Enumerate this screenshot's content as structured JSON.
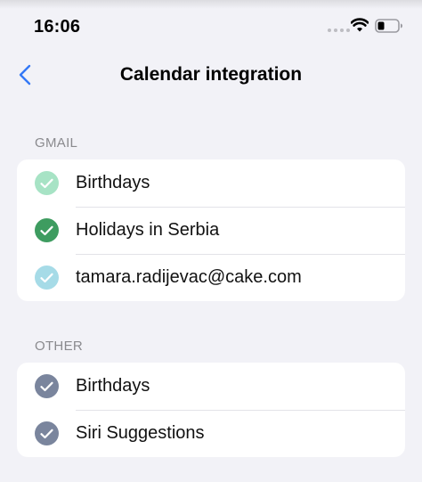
{
  "status_bar": {
    "time": "16:06",
    "icons": [
      "signal-dots-icon",
      "wifi-icon",
      "battery-icon"
    ]
  },
  "nav": {
    "back_icon": "chevron-left-icon",
    "title": "Calendar integration",
    "accent_color": "#3478f6"
  },
  "sections": [
    {
      "header": "GMAIL",
      "items": [
        {
          "label": "Birthdays",
          "color": "#a7e3c5",
          "checked": true
        },
        {
          "label": "Holidays in Serbia",
          "color": "#3e9c60",
          "checked": true
        },
        {
          "label": "tamara.radijevac@cake.com",
          "color": "#a6dbe7",
          "checked": true
        }
      ]
    },
    {
      "header": "OTHER",
      "items": [
        {
          "label": "Birthdays",
          "color": "#7a859d",
          "checked": true
        },
        {
          "label": "Siri Suggestions",
          "color": "#7a859d",
          "checked": true
        }
      ]
    }
  ]
}
